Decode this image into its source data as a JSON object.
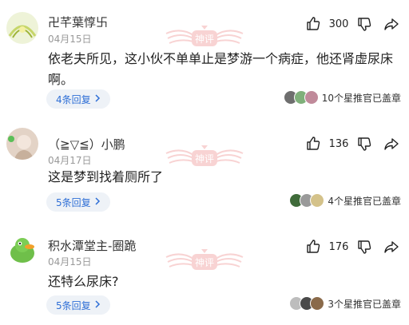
{
  "comments": [
    {
      "username": "卍芊葉惇卐",
      "date": "04月15日",
      "text": "依老夫所见，这小伙不单单止是梦游一个病症，他还肾虚尿床啊。",
      "likes": "300",
      "replies_label": "4条回复",
      "recommend_text": "10个星推官已盖章",
      "avatar_color": "#e8efd0"
    },
    {
      "username": "（≧▽≦）小鹏",
      "date": "04月17日",
      "text": "这是梦到找着厕所了",
      "likes": "136",
      "replies_label": "5条回复",
      "recommend_text": "4个星推官已盖章",
      "avatar_color": "#d9c7b8"
    },
    {
      "username": "积水潭堂主-圈跪",
      "date": "04月15日",
      "text": "还特么尿床?",
      "likes": "176",
      "replies_label": "5条回复",
      "recommend_text": "3个星推官已盖章",
      "avatar_color": "#6fbf4a"
    }
  ],
  "watermark_label": "神评",
  "accent": "#2f6fd6",
  "watermark_color": "#f2a9a9",
  "icons": [
    "thumb-up-icon",
    "thumb-down-icon",
    "share-icon",
    "chevron-right-icon"
  ]
}
